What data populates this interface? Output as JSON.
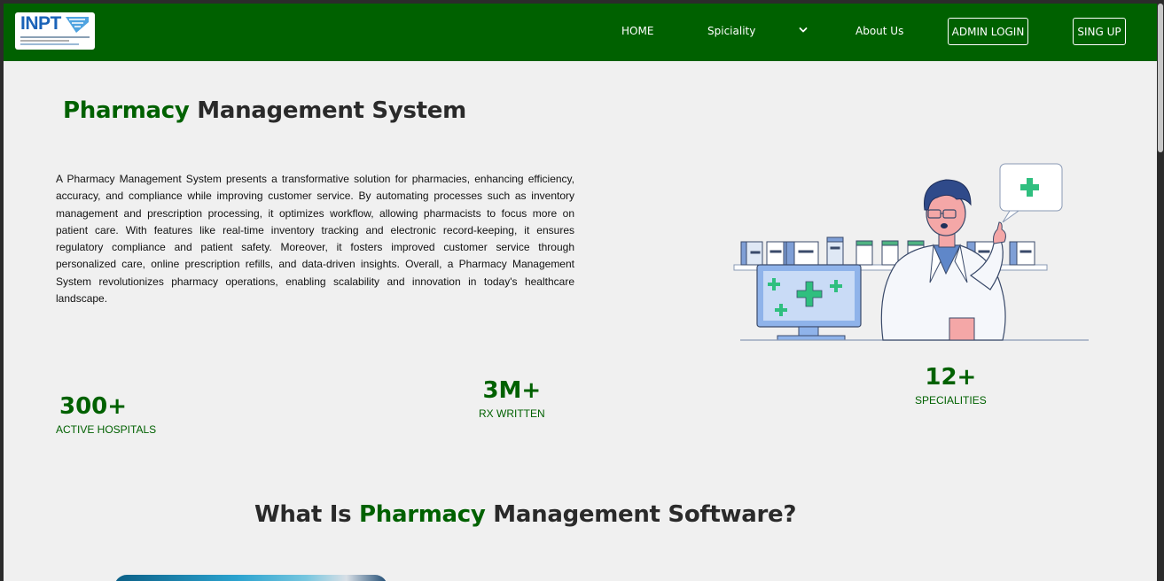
{
  "brand": {
    "logo_text": "INPT",
    "logo_icon": "inpt-logo-icon"
  },
  "nav": {
    "home": "HOME",
    "speciality": "Spiciality",
    "speciality_icon": "chevron-down-icon",
    "about": "About Us",
    "admin_login": "ADMIN LOGIN",
    "signup": "SING UP"
  },
  "hero": {
    "title_accent": "Pharmacy",
    "title_rest": " Management System",
    "description": "A Pharmacy Management System presents a transformative solution for pharmacies, enhancing efficiency, accuracy, and compliance while improving customer service. By automating processes such as inventory management and prescription processing, it optimizes workflow, allowing pharmacists to focus more on patient care. With features like real-time inventory tracking and electronic record-keeping, it ensures regulatory compliance and patient safety. Moreover, it fosters improved customer service through personalized care, online prescription refills, and data-driven insights. Overall, a Pharmacy Management System revolutionizes pharmacy operations, enabling scalability and innovation in today's healthcare landscape.",
    "illustration": "pharmacist-illustration"
  },
  "stats": [
    {
      "value": "300+",
      "label": "ACTIVE HOSPITALS"
    },
    {
      "value": "3M+",
      "label": "RX WRITTEN"
    },
    {
      "value": "12+",
      "label": "SPECIALITIES"
    }
  ],
  "section": {
    "title_lead": "What Is ",
    "title_accent": "Pharmacy",
    "title_rest": " Management Software?"
  },
  "colors": {
    "brand_green": "#006100",
    "page_bg": "#f0f0f0",
    "text_dark": "#2a2a2a"
  }
}
